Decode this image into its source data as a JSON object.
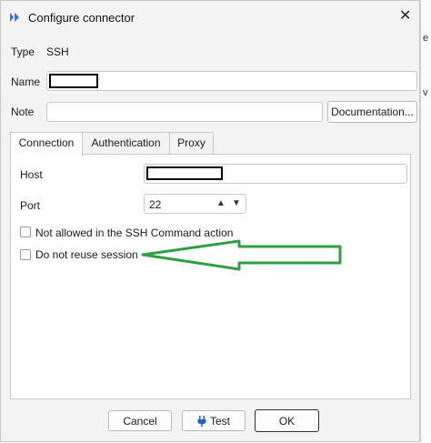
{
  "dialog": {
    "title": "Configure connector",
    "type_label": "Type",
    "type_value": "SSH",
    "name_label": "Name",
    "name_value": "",
    "note_label": "Note",
    "note_value": "",
    "documentation_button": "Documentation..."
  },
  "tabs": [
    {
      "label": "Connection",
      "active": true
    },
    {
      "label": "Authentication",
      "active": false
    },
    {
      "label": "Proxy",
      "active": false
    }
  ],
  "connection": {
    "host_label": "Host",
    "host_value": "",
    "port_label": "Port",
    "port_value": "22",
    "checkbox_ssh_action": {
      "label": "Not allowed in the SSH Command action",
      "checked": false
    },
    "checkbox_reuse": {
      "label": "Do not reuse session",
      "checked": false
    }
  },
  "footer": {
    "cancel": "Cancel",
    "test": "Test",
    "ok": "OK"
  },
  "annotation": {
    "color": "#2ea043",
    "icon": "left-arrow-outline-icon"
  },
  "background_fragments": [
    "e",
    "v"
  ],
  "icons": {
    "app": "app-logo-icon",
    "close": "close-icon",
    "up": "arrow-up-icon",
    "down": "arrow-down-icon",
    "plug": "plug-icon"
  }
}
